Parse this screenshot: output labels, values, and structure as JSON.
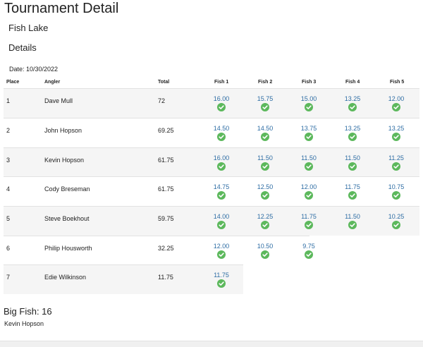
{
  "title": "Tournament Detail",
  "lake": "Fish Lake",
  "section": "Details",
  "date_label": "Date: 10/30/2022",
  "columns": {
    "place": "Place",
    "angler": "Angler",
    "total": "Total",
    "fish1": "Fish 1",
    "fish2": "Fish 2",
    "fish3": "Fish 3",
    "fish4": "Fish 4",
    "fish5": "Fish 5"
  },
  "rows": [
    {
      "place": "1",
      "angler": "Dave Mull",
      "total": "72",
      "fish": [
        "16.00",
        "15.75",
        "15.00",
        "13.25",
        "12.00"
      ]
    },
    {
      "place": "2",
      "angler": "John Hopson",
      "total": "69.25",
      "fish": [
        "14.50",
        "14.50",
        "13.75",
        "13.25",
        "13.25"
      ]
    },
    {
      "place": "3",
      "angler": "Kevin Hopson",
      "total": "61.75",
      "fish": [
        "16.00",
        "11.50",
        "11.50",
        "11.50",
        "11.25"
      ]
    },
    {
      "place": "4",
      "angler": "Cody Breseman",
      "total": "61.75",
      "fish": [
        "14.75",
        "12.50",
        "12.00",
        "11.75",
        "10.75"
      ]
    },
    {
      "place": "5",
      "angler": "Steve Boekhout",
      "total": "59.75",
      "fish": [
        "14.00",
        "12.25",
        "11.75",
        "11.50",
        "10.25"
      ]
    },
    {
      "place": "6",
      "angler": "Philip Housworth",
      "total": "32.25",
      "fish": [
        "12.00",
        "10.50",
        "9.75"
      ]
    },
    {
      "place": "7",
      "angler": "Edie Wilkinson",
      "total": "11.75",
      "fish": [
        "11.75"
      ]
    }
  ],
  "big_fish": {
    "label": "Big Fish: 16",
    "angler": "Kevin Hopson"
  },
  "colors": {
    "weight_link": "#2e6da4",
    "check": "#5cb85c",
    "row_shade": "#f5f5f5"
  },
  "icons": {
    "verified": "check-circle-icon"
  }
}
